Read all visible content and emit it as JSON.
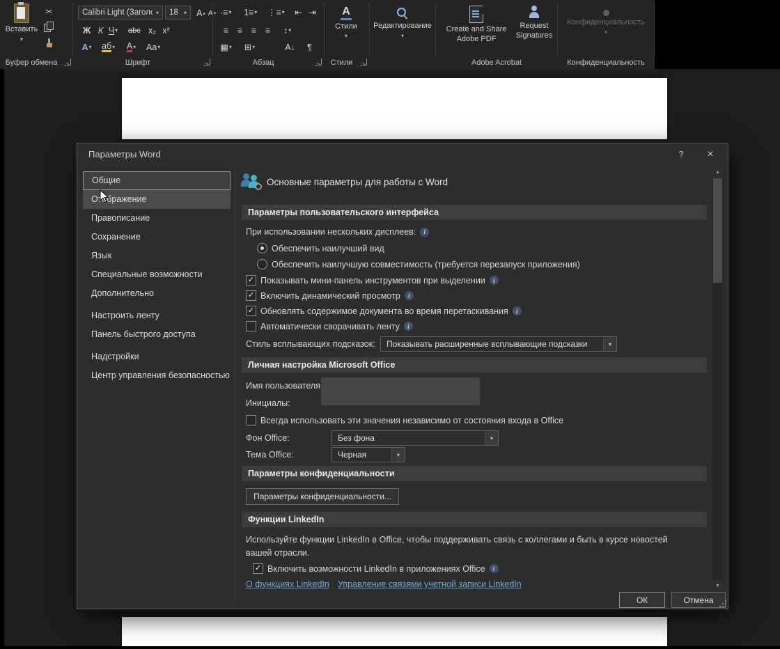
{
  "icons": {
    "caret": "▾",
    "scissors": "✂",
    "check": "✓",
    "up": "▴",
    "down": "▾",
    "bullets": "∙≡",
    "numbered": "1≡",
    "multilevel": "⋮≡",
    "indent_dec": "⇤",
    "indent_inc": "⇥",
    "align_left": "≡",
    "align_center": "≡",
    "align_right": "≡",
    "align_justify": "≡",
    "spacing": "↕",
    "shading": "▦",
    "borders": "⊞",
    "sort": "А↓",
    "pilcrow": "¶",
    "scroll_up": "▲",
    "scroll_down": "▼"
  },
  "ribbon": {
    "paste_label": "Вставить",
    "font_name": "Calibri Light (Заголов",
    "font_size": "18",
    "letterA": "А",
    "font_bold": "Ж",
    "font_italic": "К",
    "font_underline": "Ч",
    "font_strike": "abc",
    "font_sub": "x₂",
    "font_sup": "x²",
    "font_highlight": "аб",
    "font_case": "Aa",
    "styles_label": "Стили",
    "editing_label": "Редактирование",
    "adobe_pdf_label": "Create and Share Adobe PDF",
    "request_sig_label": "Request Signatures",
    "confidentiality_label": "Конфиденциальность",
    "groups": {
      "clipboard": "Буфер обмена",
      "font": "Шрифт",
      "paragraph": "Абзац",
      "styles": "Стили",
      "adobe": "Adobe Acrobat",
      "confidentiality": "Конфиденциальность"
    }
  },
  "dialog": {
    "title": "Параметры Word",
    "help": "?",
    "close": "×",
    "sidebar": [
      "Общие",
      "Отображение",
      "Правописание",
      "Сохранение",
      "Язык",
      "Специальные возможности",
      "Дополнительно",
      "Настроить ленту",
      "Панель быстрого доступа",
      "Надстройки",
      "Центр управления безопасностью"
    ],
    "header": "Основные параметры для работы с Word",
    "ui_section": {
      "title": "Параметры пользовательского интерфейса",
      "multi_display_label": "При использовании нескольких дисплеев:",
      "radio_best_look": "Обеспечить наилучший вид",
      "radio_compat": "Обеспечить наилучшую совместимость (требуется перезапуск приложения)",
      "cb_minitoolbar": "Показывать мини-панель инструментов при выделении",
      "cb_live_preview": "Включить динамический просмотр",
      "cb_drag_update": "Обновлять содержимое документа во время перетаскивания",
      "cb_collapse_ribbon": "Автоматически сворачивать ленту",
      "tooltip_label": "Стиль всплывающих подсказок:",
      "tooltip_value": "Показывать расширенные всплывающие подсказки"
    },
    "personal_section": {
      "title": "Личная настройка Microsoft Office",
      "username_label": "Имя пользователя:",
      "initials_label": "Инициалы:",
      "cb_always": "Всегда использовать эти значения независимо от состояния входа в Office",
      "background_label": "Фон Office:",
      "background_value": "Без фона",
      "theme_label": "Тема Office:",
      "theme_value": "Черная"
    },
    "privacy_section": {
      "title": "Параметры конфиденциальности",
      "button": "Параметры конфиденциальности..."
    },
    "linkedin_section": {
      "title": "Функции LinkedIn",
      "description": "Используйте функции LinkedIn в Office, чтобы поддерживать связь с коллегами и быть в курсе новостей вашей отрасли.",
      "cb_enable": "Включить возможности LinkedIn в приложениях Office",
      "link_about": "О функциях LinkedIn",
      "link_manage": "Управление связями учетной записи LinkedIn"
    },
    "ok": "ОК",
    "cancel": "Отмена"
  }
}
